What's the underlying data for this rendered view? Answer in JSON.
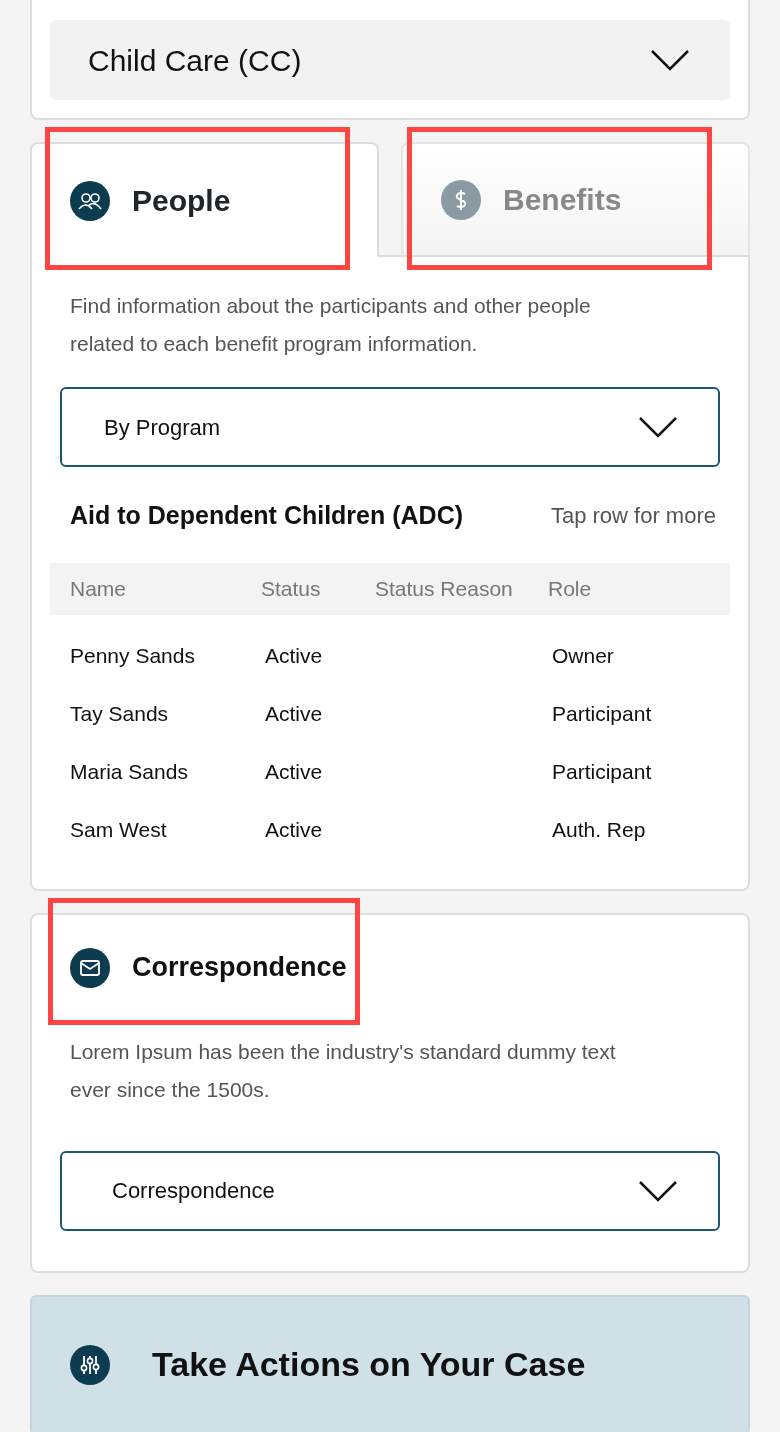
{
  "program_select": {
    "value": "Child Care (CC)"
  },
  "tabs": [
    {
      "label": "People",
      "kind": "people",
      "selected": true,
      "highlighted": true
    },
    {
      "label": "Benefits",
      "kind": "dollar",
      "selected": false,
      "highlighted": true
    }
  ],
  "people_panel": {
    "description": "Find information about the participants and other people related to each benefit program information.",
    "filter_select": {
      "value": "By Program"
    },
    "program_title": "Aid to Dependent Children (ADC)",
    "hint": "Tap row for more",
    "table": {
      "columns": [
        "Name",
        "Status",
        "Status Reason",
        "Role"
      ],
      "rows": [
        [
          "Penny Sands",
          "Active",
          "",
          "Owner"
        ],
        [
          "Tay Sands",
          "Active",
          "",
          "Participant"
        ],
        [
          "Maria Sands",
          "Active",
          "",
          "Participant"
        ],
        [
          "Sam West",
          "Active",
          "",
          "Auth. Rep"
        ]
      ]
    }
  },
  "correspondence": {
    "title": "Correspondence",
    "highlighted": true,
    "description": "Lorem Ipsum has been the industry's standard dummy text ever since the 1500s.",
    "select": {
      "value": "Correspondence"
    }
  },
  "actions": {
    "title": "Take Actions on Your Case"
  }
}
